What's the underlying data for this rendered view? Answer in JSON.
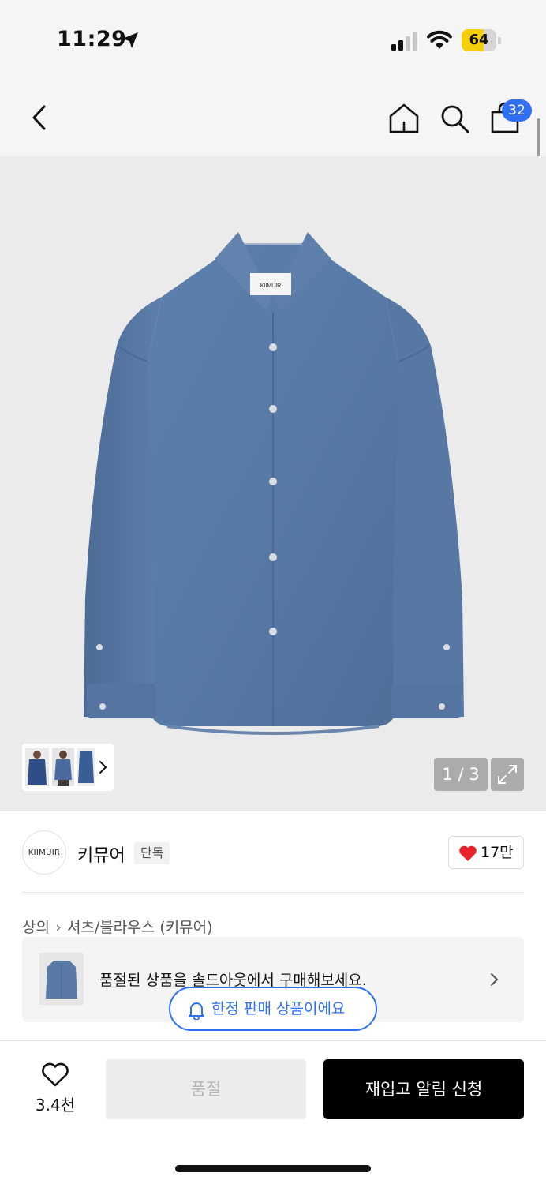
{
  "status_bar": {
    "time": "11:29",
    "battery": "64",
    "battery_level": 0.64,
    "battery_color": "#f5cf0a"
  },
  "nav": {
    "back_icon": "chevron-left-icon",
    "home_icon": "home-icon",
    "search_icon": "search-icon",
    "bag_icon": "shopping-bag-icon",
    "cart_count": "32",
    "badge_color": "#2f6ff3"
  },
  "gallery": {
    "label_text": "KIIMUIR",
    "counter": "1 / 3",
    "expand_icon": "expand-icon",
    "thumbnail_arrow_icon": "chevron-right-icon"
  },
  "brand": {
    "logo_text": "KIIMUIR",
    "name": "키뮤어",
    "tag": "단독",
    "likes": "17만",
    "heart_color": "#e8232b"
  },
  "breadcrumb": {
    "items": [
      "상의",
      "셔츠/블라우스 (키뮤어)"
    ]
  },
  "promo": {
    "text": "품절된 상품을 솔드아웃에서 구매해보세요.",
    "arrow_icon": "chevron-right-icon"
  },
  "limited_badge": {
    "icon": "bell-icon",
    "text": "한정 판매 상품이에요"
  },
  "bottom_bar": {
    "wish_icon": "heart-outline-icon",
    "wish_count": "3.4천",
    "soldout_label": "품절",
    "restock_label": "재입고 알림 신청"
  }
}
